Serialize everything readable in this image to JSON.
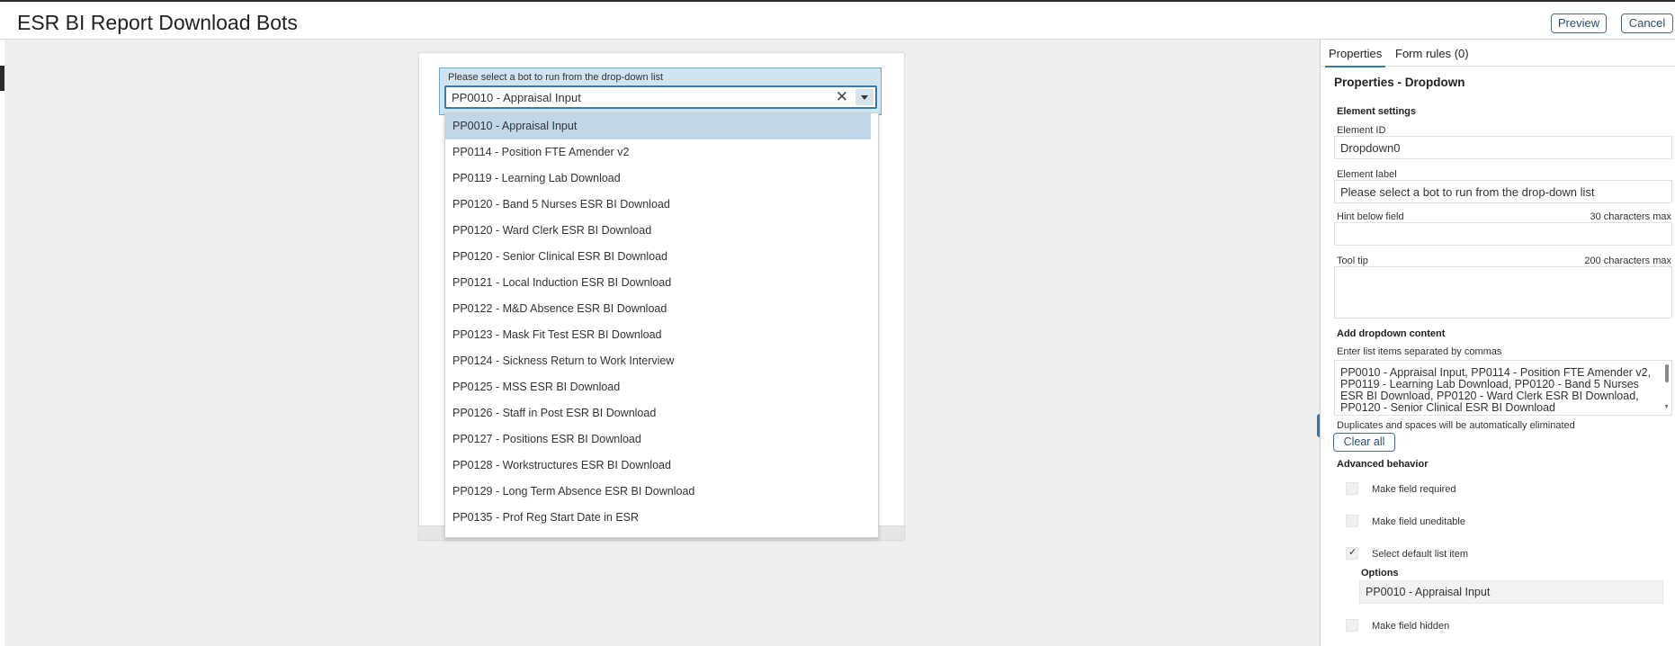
{
  "header": {
    "title": "ESR BI Report Download Bots",
    "preview_label": "Preview",
    "cancel_label": "Cancel"
  },
  "form": {
    "dropdown_label": "Please select a bot to run from the drop-down list",
    "dropdown_value": "PP0010 - Appraisal Input",
    "clear_glyph": "✕",
    "options": [
      "PP0010 - Appraisal Input",
      "PP0114 - Position FTE Amender v2",
      "PP0119 - Learning Lab Download",
      "PP0120 - Band 5 Nurses ESR BI Download",
      "PP0120 - Ward Clerk ESR BI Download",
      "PP0120 - Senior Clinical ESR BI Download",
      "PP0121 - Local Induction ESR BI Download",
      "PP0122 - M&D Absence ESR BI Download",
      "PP0123 - Mask Fit Test ESR BI Download",
      "PP0124 - Sickness Return to Work Interview",
      "PP0125 - MSS ESR BI Download",
      "PP0126 - Staff in Post ESR BI Download",
      "PP0127 - Positions ESR BI Download",
      "PP0128 - Workstructures ESR BI Download",
      "PP0129 - Long Term Absence ESR BI Download",
      "PP0135 - Prof Reg Start Date in ESR"
    ]
  },
  "panel": {
    "tab_properties": "Properties",
    "tab_form_rules": "Form rules (0)",
    "title": "Properties - Dropdown",
    "element_settings": "Element settings",
    "element_id_label": "Element ID",
    "element_id_value": "Dropdown0",
    "element_label_label": "Element label",
    "element_label_value": "Please select a bot to run from the drop-down list",
    "hint_label": "Hint below field",
    "hint_max": "30 characters max",
    "tooltip_label": "Tool tip",
    "tooltip_max": "200 characters max",
    "add_content": "Add dropdown content",
    "list_items_label": "Enter list items separated by commas",
    "list_items_value": "PP0010 - Appraisal Input, PP0114 - Position FTE Amender v2, PP0119 - Learning Lab Download, PP0120 - Band 5 Nurses ESR BI Download, PP0120 - Ward Clerk ESR BI Download, PP0120 - Senior Clinical ESR BI Download",
    "duplicates_note": "Duplicates and spaces will be automatically eliminated",
    "clear_all": "Clear all",
    "advanced": "Advanced behavior",
    "make_required": "Make field required",
    "make_uneditable": "Make field uneditable",
    "select_default": "Select default list item",
    "options_label": "Options",
    "options_value": "PP0010 - Appraisal Input",
    "make_hidden": "Make field hidden"
  }
}
